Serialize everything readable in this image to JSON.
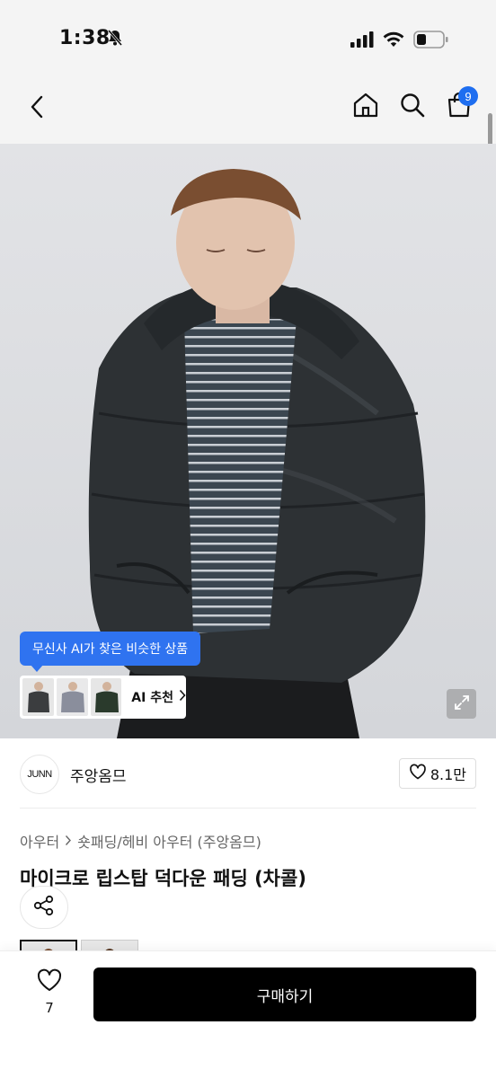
{
  "status_bar": {
    "time": "1:38",
    "icons": [
      "bell-slash-icon",
      "signal-icon",
      "wifi-icon",
      "battery-icon"
    ]
  },
  "nav": {
    "icons": [
      "back-icon",
      "home-icon",
      "search-icon",
      "cart-icon"
    ],
    "cart_count": "9"
  },
  "product_image": {
    "ai_tooltip": "무신사 AI가 찾은 비슷한 상품",
    "ai_reco_label": "AI 추천",
    "expand_icon": "expand-icon"
  },
  "brand": {
    "logo_text": "JUNN",
    "name": "주앙옴므",
    "like_count": "8.1만"
  },
  "category": {
    "level1": "아우터",
    "level2": "숏패딩/헤비 아우터 (주앙옴므)"
  },
  "product": {
    "title": "마이크로 립스탑 덕다운 패딩 (차콜)"
  },
  "bottom_bar": {
    "wish_count": "7",
    "buy_label": "구매하기"
  },
  "colors": {
    "accent_blue": "#2f73f0",
    "badge_blue": "#1e6ef0",
    "buy_button": "#000000"
  }
}
